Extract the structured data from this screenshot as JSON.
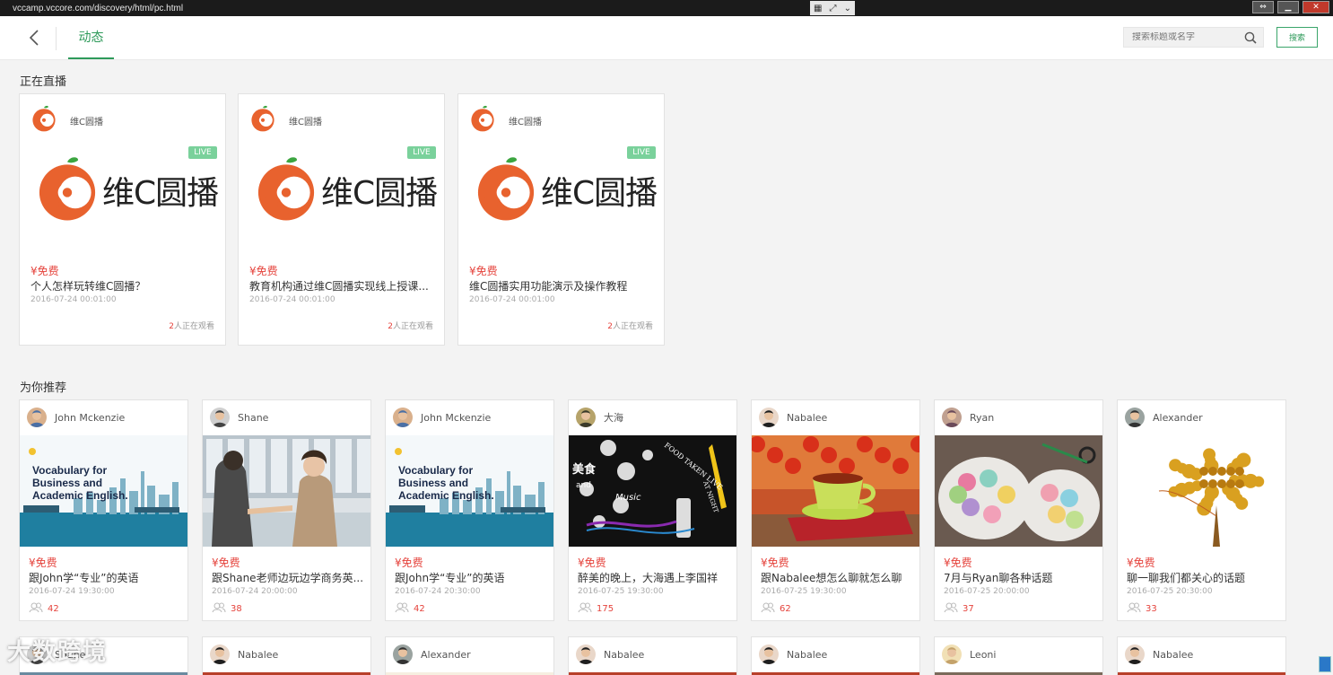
{
  "window": {
    "url": "vccamp.vccore.com/discovery/html/pc.html"
  },
  "nav": {
    "tab_label": "动态",
    "search_placeholder": "搜索标题或名字",
    "search_button": "搜索"
  },
  "live_section": {
    "title": "正在直播",
    "cards": [
      {
        "org": "维C圆播",
        "badge": "LIVE",
        "logo_text": "维C圆播",
        "price": "¥免费",
        "title": "个人怎样玩转维C圆播？",
        "time": "2016-07-24 00:01:00",
        "watch_count": "2",
        "watch_label": "人正在观看"
      },
      {
        "org": "维C圆播",
        "badge": "LIVE",
        "logo_text": "维C圆播",
        "price": "¥免费",
        "title": "教育机构通过维C圆播实现线上授课...",
        "time": "2016-07-24 00:01:00",
        "watch_count": "2",
        "watch_label": "人正在观看"
      },
      {
        "org": "维C圆播",
        "badge": "LIVE",
        "logo_text": "维C圆播",
        "price": "¥免费",
        "title": "维C圆播实用功能演示及操作教程",
        "time": "2016-07-24 00:01:00",
        "watch_count": "2",
        "watch_label": "人正在观看"
      }
    ]
  },
  "rec_section": {
    "title": "为你推荐",
    "cards": [
      {
        "name": "John Mckenzie",
        "price": "¥免费",
        "title": "跟John学“专业”的英语",
        "time": "2016-07-24 19:30:00",
        "count": "42",
        "img_text": [
          "Vocabulary for",
          "Business and",
          "Academic English."
        ]
      },
      {
        "name": "Shane",
        "price": "¥免费",
        "title": "跟Shane老师边玩边学商务英...",
        "time": "2016-07-24 20:00:00",
        "count": "38"
      },
      {
        "name": "John Mckenzie",
        "price": "¥免费",
        "title": "跟John学“专业”的英语",
        "time": "2016-07-24 20:30:00",
        "count": "42",
        "img_text": [
          "Vocabulary for",
          "Business and",
          "Academic English."
        ]
      },
      {
        "name": "大海",
        "price": "¥免费",
        "title": "醉美的晚上，大海遇上李国祥",
        "time": "2016-07-25 19:30:00",
        "count": "175",
        "img_text": [
          "美食",
          "and",
          "Music",
          "FOOD TAKEN LIVE",
          "AT NIGHT"
        ]
      },
      {
        "name": "Nabalee",
        "price": "¥免费",
        "title": "跟Nabalee想怎么聊就怎么聊",
        "time": "2016-07-25 19:30:00",
        "count": "62"
      },
      {
        "name": "Ryan",
        "price": "¥免费",
        "title": "7月与Ryan聊各种话题",
        "time": "2016-07-25 20:00:00",
        "count": "37"
      },
      {
        "name": "Alexander",
        "price": "¥免费",
        "title": "聊一聊我们都关心的话题",
        "time": "2016-07-25 20:30:00",
        "count": "33"
      }
    ],
    "row2_names": [
      "Shane",
      "Nabalee",
      "Alexander",
      "Nabalee",
      "Nabalee",
      "Leoni",
      "Nabalee"
    ]
  },
  "watermark": "大数跨境",
  "colors": {
    "accent": "#2e9a5a",
    "price": "#e5433c",
    "live_badge": "#7ad19b",
    "logo_orange": "#e8622e"
  }
}
